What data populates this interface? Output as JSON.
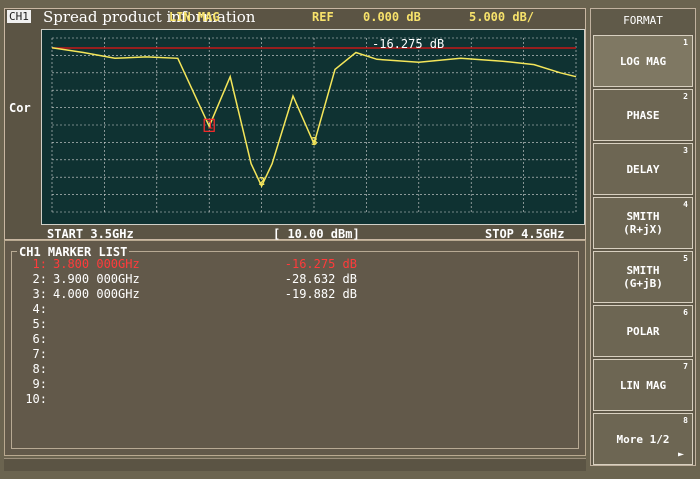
{
  "top": {
    "channel_tag": "CH1",
    "overlay_text": "Spread product information",
    "lin_mag_label": "LIN MAG",
    "ref_label": "REF",
    "ref_value": "0.000 dB",
    "scale_value": "5.000 dB/",
    "marker_readout": "-16.275 dB",
    "cor_label": "Cor",
    "start_label": "START 3.5GHz",
    "center_label": "[ 10.00 dBm]",
    "stop_label": "STOP 4.5GHz"
  },
  "chart_data": {
    "type": "line",
    "xlabel": "",
    "ylabel": "",
    "xlim": [
      3.5,
      4.5
    ],
    "series": [
      {
        "points": [
          [
            3.5,
            0.0
          ],
          [
            3.56,
            -1.0
          ],
          [
            3.62,
            -2.2
          ],
          [
            3.68,
            -1.9
          ],
          [
            3.74,
            -2.2
          ],
          [
            3.8,
            -16.275
          ],
          [
            3.84,
            -6.0
          ],
          [
            3.88,
            -24.0
          ],
          [
            3.9,
            -28.632
          ],
          [
            3.92,
            -24.0
          ],
          [
            3.96,
            -10.0
          ],
          [
            4.0,
            -19.882
          ],
          [
            4.04,
            -4.5
          ],
          [
            4.08,
            -1.0
          ],
          [
            4.12,
            -2.4
          ],
          [
            4.2,
            -3.0
          ],
          [
            4.28,
            -2.2
          ],
          [
            4.36,
            -2.8
          ],
          [
            4.42,
            -3.5
          ],
          [
            4.47,
            -5.2
          ],
          [
            4.5,
            -6.0
          ]
        ]
      }
    ],
    "markers": [
      {
        "label": "1",
        "freq": 3.8,
        "value": -16.275
      },
      {
        "label": "2",
        "freq": 3.9,
        "value": -28.632
      },
      {
        "label": "3",
        "freq": 4.0,
        "value": -19.882
      }
    ]
  },
  "marker_list": {
    "title": "CH1 MARKER LIST",
    "rows": [
      {
        "idx": "1:",
        "freq": "3.800 000GHz",
        "value": "-16.275 dB",
        "active": true
      },
      {
        "idx": "2:",
        "freq": "3.900 000GHz",
        "value": "-28.632 dB",
        "active": false
      },
      {
        "idx": "3:",
        "freq": "4.000 000GHz",
        "value": "-19.882 dB",
        "active": false
      },
      {
        "idx": "4:",
        "freq": "",
        "value": "",
        "active": false
      },
      {
        "idx": "5:",
        "freq": "",
        "value": "",
        "active": false
      },
      {
        "idx": "6:",
        "freq": "",
        "value": "",
        "active": false
      },
      {
        "idx": "7:",
        "freq": "",
        "value": "",
        "active": false
      },
      {
        "idx": "8:",
        "freq": "",
        "value": "",
        "active": false
      },
      {
        "idx": "9:",
        "freq": "",
        "value": "",
        "active": false
      },
      {
        "idx": "10:",
        "freq": "",
        "value": "",
        "active": false
      }
    ]
  },
  "softkeys": {
    "title": "FORMAT",
    "items": [
      {
        "num": "1",
        "label": "LOG MAG"
      },
      {
        "num": "2",
        "label": "PHASE"
      },
      {
        "num": "3",
        "label": "DELAY"
      },
      {
        "num": "4",
        "label": "SMITH\n(R+jX)"
      },
      {
        "num": "5",
        "label": "SMITH\n(G+jB)"
      },
      {
        "num": "6",
        "label": "POLAR"
      },
      {
        "num": "7",
        "label": "LIN MAG"
      },
      {
        "num": "8",
        "label": "More 1/2"
      }
    ],
    "active_index": 0
  },
  "colors": {
    "trace": "#f4e65a",
    "ref_line": "#c31818",
    "grid": "#d8d8d8"
  }
}
